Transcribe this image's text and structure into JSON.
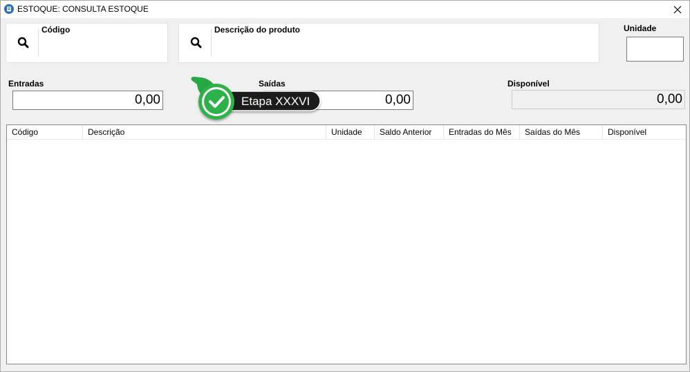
{
  "window": {
    "title": "ESTOQUE: CONSULTA ESTOQUE"
  },
  "search": {
    "codigo_label": "Código",
    "codigo_value": "",
    "descricao_label": "Descrição do produto",
    "descricao_value": ""
  },
  "unidade": {
    "label": "Unidade",
    "value": ""
  },
  "totals": {
    "entradas_label": "Entradas",
    "entradas_value": "0,00",
    "saidas_label": "Saídas",
    "saidas_value": "0,00",
    "disponivel_label": "Disponível",
    "disponivel_value": "0,00"
  },
  "grid": {
    "columns": [
      "Código",
      "Descrição",
      "Unidade",
      "Saldo Anterior",
      "Entradas do Mês",
      "Saídas do Mês",
      "Disponível"
    ],
    "rows": []
  },
  "badge": {
    "text": "Etapa XXXVI",
    "color": "#2db24a"
  },
  "icons": {
    "app": "app-icon",
    "close": "close-icon",
    "search": "search-icon",
    "check": "check-icon"
  }
}
